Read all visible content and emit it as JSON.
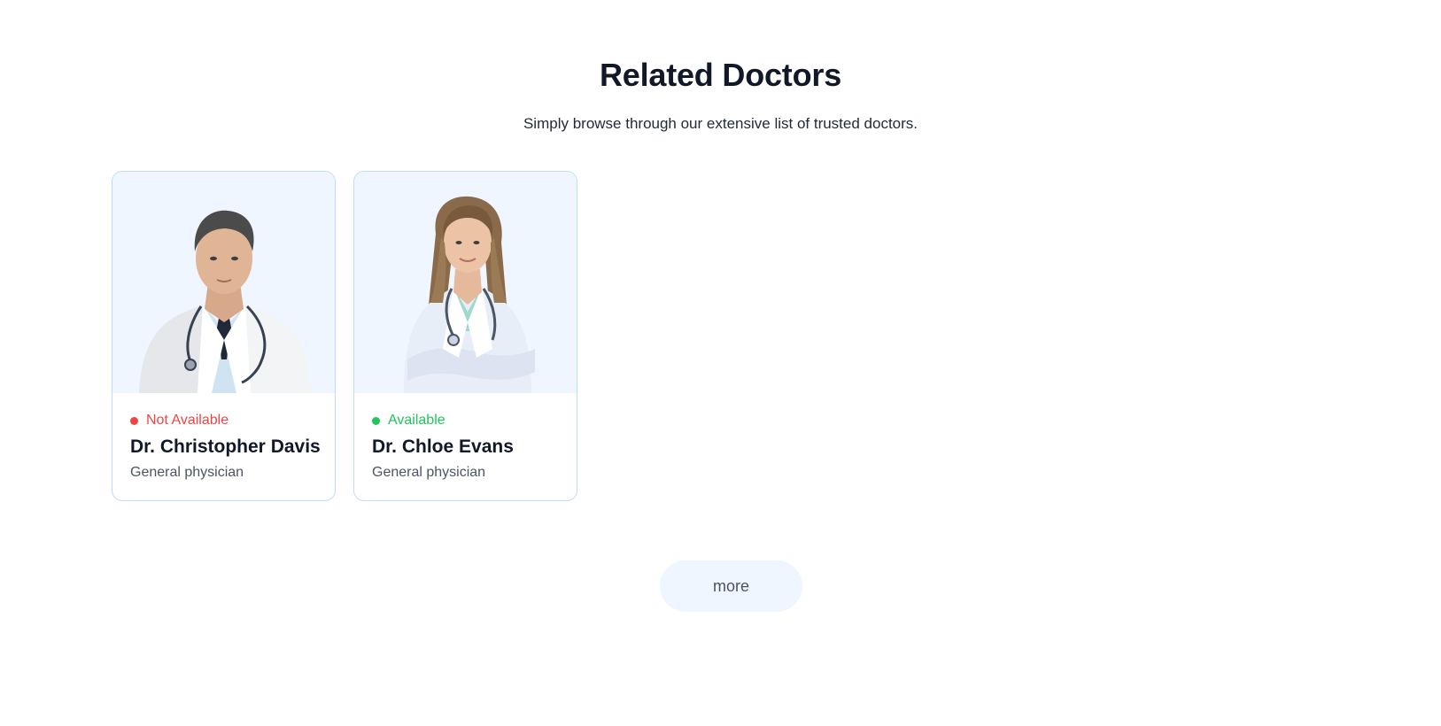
{
  "section": {
    "title": "Related Doctors",
    "subtitle": "Simply browse through our extensive list of trusted doctors."
  },
  "doctors": [
    {
      "status": "Not Available",
      "status_color": "#ef4444",
      "name": "Dr. Christopher Davis",
      "speciality": "General physician",
      "photo": "male-doctor-portrait"
    },
    {
      "status": "Available",
      "status_color": "#22c55e",
      "name": "Dr. Chloe Evans",
      "speciality": "General physician",
      "photo": "female-doctor-portrait"
    }
  ],
  "more_button": {
    "label": "more"
  },
  "colors": {
    "card_border": "#bfdbfe",
    "photo_background": "#eff6ff",
    "button_background": "#eff6ff"
  }
}
